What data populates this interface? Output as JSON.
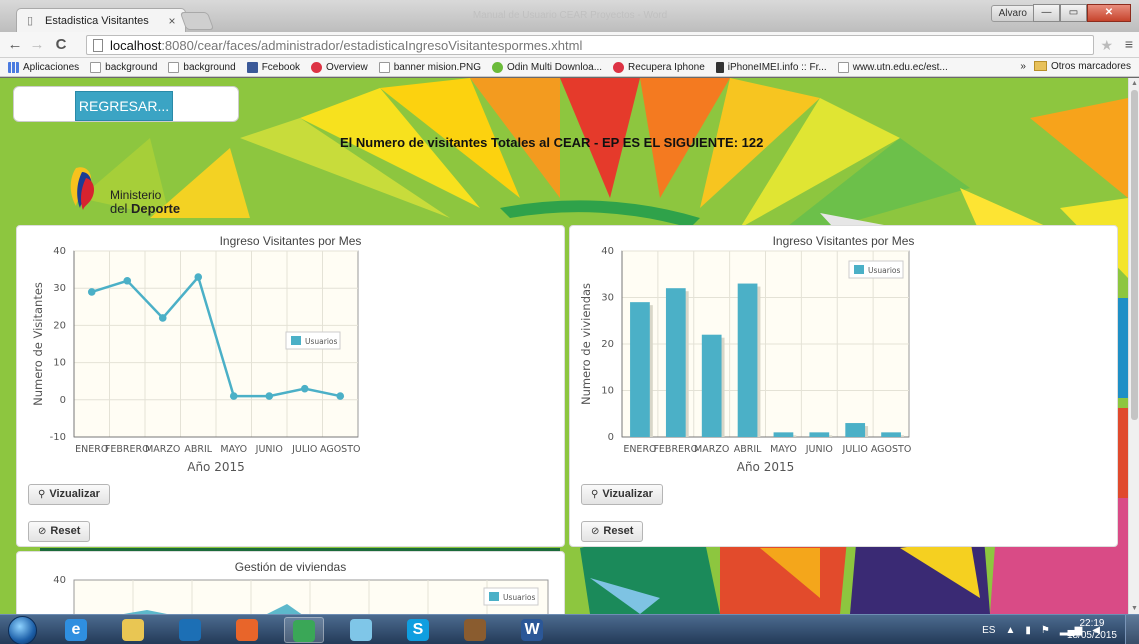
{
  "browser": {
    "tab_title": "Estadistica Visitantes",
    "tab_close": "×",
    "window_title": "Manual de Usuario CEAR Proyectos - Word",
    "user_button": "Alvaro",
    "url_host": "localhost",
    "url_path": ":8080/cear/faces/administrador/estadisticaIngresoVisitantespormes.xhtml",
    "bookmarks": [
      {
        "label": "Aplicaciones",
        "icon": "apps-icon"
      },
      {
        "label": "background",
        "icon": "page-icon"
      },
      {
        "label": "background",
        "icon": "page-icon"
      },
      {
        "label": "Fcebook",
        "icon": "facebook-icon"
      },
      {
        "label": "Overview",
        "icon": "overview-icon"
      },
      {
        "label": "banner mision.PNG",
        "icon": "page-icon"
      },
      {
        "label": "Odin Multi Downloa...",
        "icon": "android-icon"
      },
      {
        "label": "Recupera Iphone",
        "icon": "heart-icon"
      },
      {
        "label": "iPhoneIMEI.info :: Fr...",
        "icon": "phone-icon"
      },
      {
        "label": "www.utn.edu.ec/est...",
        "icon": "page-icon"
      }
    ],
    "more_bookmarks": "»",
    "other_bookmarks": "Otros marcadores"
  },
  "page": {
    "back_button": "REGRESAR...",
    "headline": "El Numero de visitantes Totales al CEAR - EP ES EL SIGUIENTE: 122",
    "logo_line1": "Ministerio",
    "logo_line2_prefix": "del ",
    "logo_line2_bold": "Deporte",
    "view_button": "Vizualizar",
    "reset_button": "Reset"
  },
  "colors": {
    "series": "#4bb0c7",
    "page_bg": "#8dc63f",
    "button_blue": "#3ba4c4"
  },
  "chart_data": [
    {
      "type": "line",
      "title": "Ingreso Visitantes por Mes",
      "xlabel": "Año 2015",
      "ylabel": "Numero de Visitantes",
      "categories": [
        "ENERO",
        "FEBRERO",
        "MARZO",
        "ABRIL",
        "MAYO",
        "JUNIO",
        "JULIO",
        "AGOSTO"
      ],
      "series": [
        {
          "name": "Usuarios",
          "values": [
            29,
            32,
            22,
            33,
            1,
            1,
            3,
            1
          ]
        }
      ],
      "ylim": [
        -10,
        40
      ],
      "yticks": [
        -10,
        0,
        10,
        20,
        30,
        40
      ],
      "legend": "center-right",
      "grid": true
    },
    {
      "type": "bar",
      "title": "Ingreso Visitantes por Mes",
      "xlabel": "Año 2015",
      "ylabel": "Numero de viviendas",
      "categories": [
        "ENERO",
        "FEBRERO",
        "MARZO",
        "ABRIL",
        "MAYO",
        "JUNIO",
        "JULIO",
        "AGOSTO"
      ],
      "series": [
        {
          "name": "Usuarios",
          "values": [
            29,
            32,
            22,
            33,
            1,
            1,
            3,
            1
          ]
        }
      ],
      "ylim": [
        0,
        40
      ],
      "yticks": [
        0,
        10,
        20,
        30,
        40
      ],
      "legend": "top-right",
      "grid": true
    },
    {
      "type": "area",
      "title": "Gestión de viviendas",
      "ylabel": "",
      "yticks": [
        40
      ],
      "series": [
        {
          "name": "Usuarios",
          "values": []
        }
      ],
      "legend": "top-right",
      "grid": true
    }
  ],
  "taskbar": {
    "apps": [
      {
        "icon": "ie-icon",
        "label": "e"
      },
      {
        "icon": "explorer-icon",
        "label": ""
      },
      {
        "icon": "media-player-icon",
        "label": ""
      },
      {
        "icon": "firefox-icon",
        "label": ""
      },
      {
        "icon": "chrome-icon",
        "label": ""
      },
      {
        "icon": "folder-icon",
        "label": ""
      },
      {
        "icon": "skype-icon",
        "label": "S"
      },
      {
        "icon": "app-icon",
        "label": ""
      },
      {
        "icon": "word-icon",
        "label": "W"
      }
    ],
    "language": "ES",
    "time": "22:19",
    "date": "18/05/2015"
  }
}
